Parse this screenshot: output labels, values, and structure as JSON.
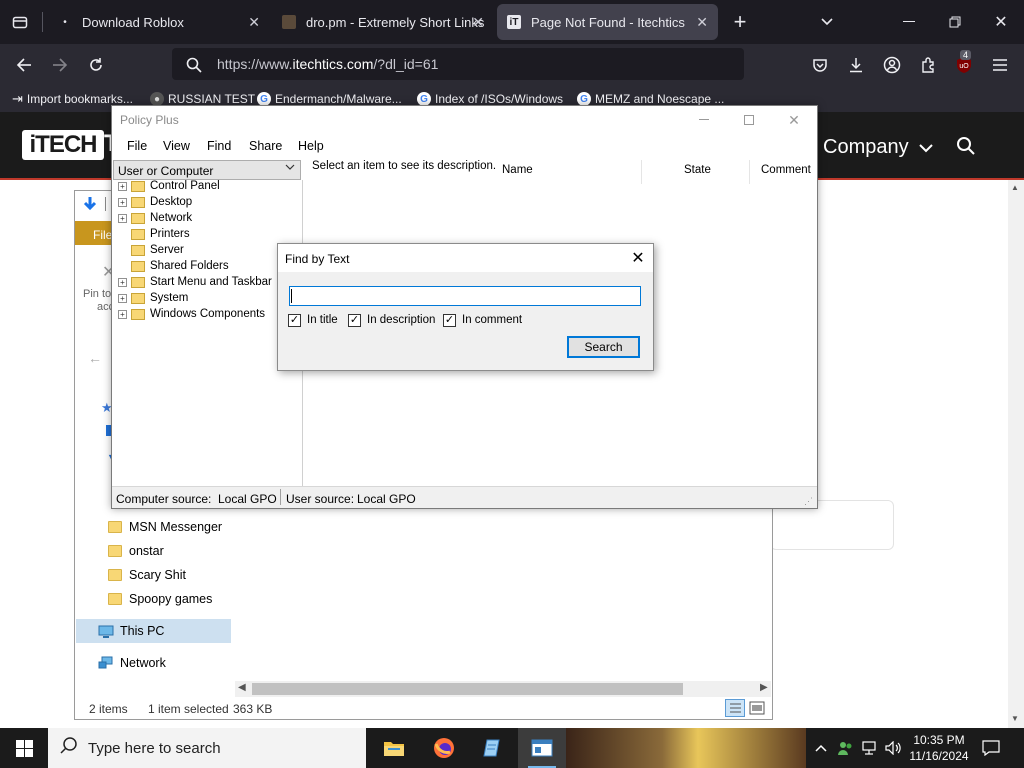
{
  "browser": {
    "tabs": [
      {
        "title": "Download Roblox",
        "active": false
      },
      {
        "title": "dro.pm - Extremely Short Links",
        "active": false
      },
      {
        "title": "Page Not Found - Itechtics",
        "active": true
      }
    ],
    "url_prefix": "https://www.",
    "url_domain": "itechtics.com",
    "url_rest": "/?dl_id=61",
    "badge_count": "4",
    "bookmarks": [
      "Import bookmarks...",
      "RUSSIAN TEST",
      "Endermanch/Malware...",
      "Index of /ISOs/Windows",
      "MEMZ and Noescape ..."
    ]
  },
  "website": {
    "logo": "iTECH",
    "logo_rest": "T",
    "nav_company": "Company"
  },
  "explorer": {
    "ribbon_tab": "File",
    "pin_label_1": "Pin to",
    "pin_label_2": "acc",
    "folders": [
      "MSN Messenger",
      "onstar",
      "Scary Shit",
      "Spoopy games"
    ],
    "this_pc": "This PC",
    "network": "Network",
    "status_items": "2 items",
    "status_selected": "1 item selected",
    "status_size": "363 KB"
  },
  "policy_plus": {
    "title": "Policy Plus",
    "menu": [
      "File",
      "View",
      "Find",
      "Share",
      "Help"
    ],
    "scope_dropdown": "User or Computer",
    "tree": [
      {
        "label": "Control Panel",
        "expandable": true
      },
      {
        "label": "Desktop",
        "expandable": true
      },
      {
        "label": "Network",
        "expandable": true
      },
      {
        "label": "Printers",
        "expandable": false
      },
      {
        "label": "Server",
        "expandable": false
      },
      {
        "label": "Shared Folders",
        "expandable": false
      },
      {
        "label": "Start Menu and Taskbar",
        "expandable": true
      },
      {
        "label": "System",
        "expandable": true
      },
      {
        "label": "Windows Components",
        "expandable": true
      }
    ],
    "description_prompt": "Select an item to see its description.",
    "columns": [
      "Name",
      "State",
      "Comment"
    ],
    "status_computer_label": "Computer source:",
    "status_computer_value": "Local GPO",
    "status_user_label": "User source:",
    "status_user_value": "Local GPO"
  },
  "find_dialog": {
    "title": "Find by Text",
    "input_value": "",
    "options": [
      {
        "label": "In title",
        "checked": true
      },
      {
        "label": "In description",
        "checked": true
      },
      {
        "label": "In comment",
        "checked": true
      }
    ],
    "search_button": "Search"
  },
  "taskbar": {
    "search_placeholder": "Type here to search",
    "time": "10:35 PM",
    "date": "11/16/2024"
  },
  "colors": {
    "browser_bg": "#1c1b22",
    "accent_blue": "#0078d7",
    "site_accent": "#c0392b"
  }
}
